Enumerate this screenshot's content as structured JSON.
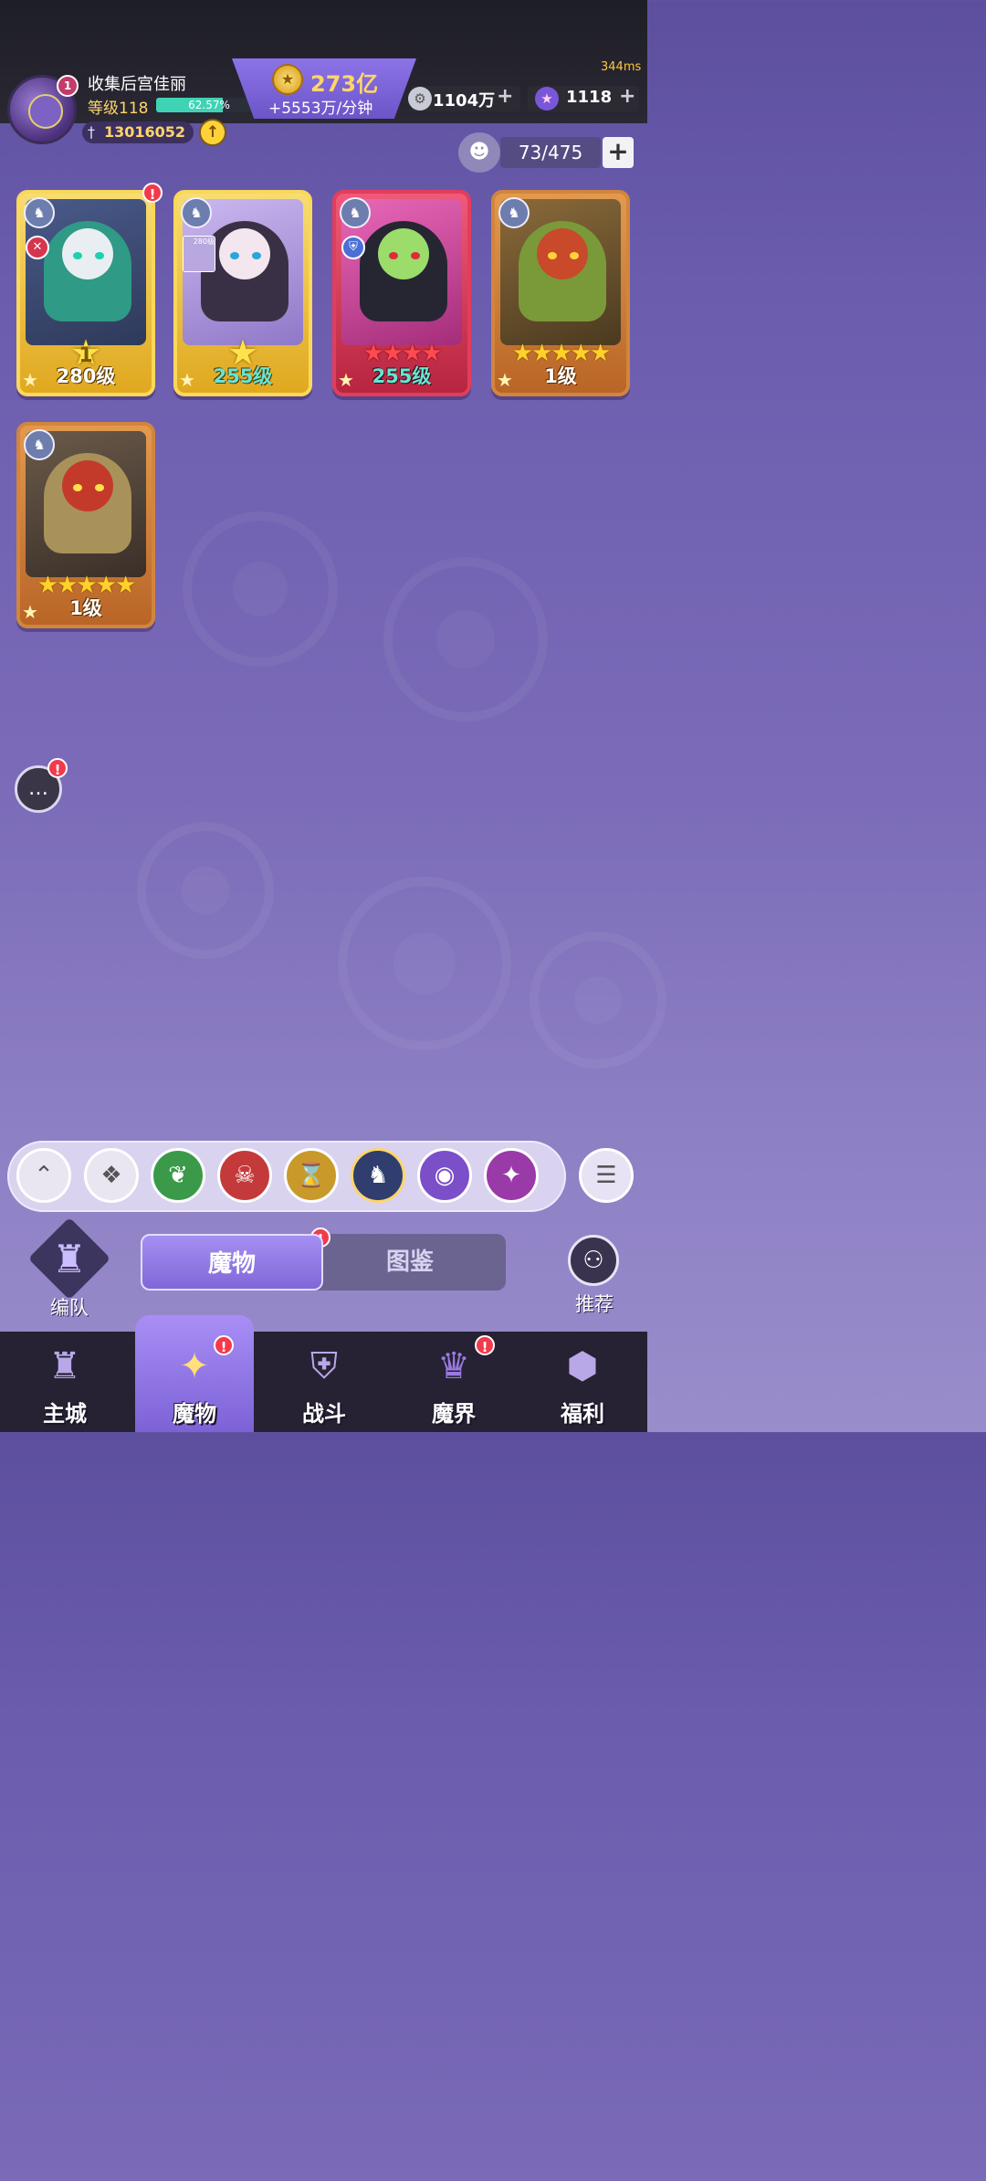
{
  "status": {
    "latency": "344ms"
  },
  "player": {
    "name": "收集后宫佳丽",
    "level_label": "等级118",
    "exp_percent_text": "62.57%",
    "exp_fraction": 0.6257,
    "power": "13016052",
    "avatar_badge": "1"
  },
  "gold": {
    "amount": "273亿",
    "rate": "+5553万/分钟"
  },
  "currencies": [
    {
      "name": "silver-coin",
      "value": "1104万",
      "plus": "+"
    },
    {
      "name": "star-gem",
      "value": "1118",
      "plus": "+"
    }
  ],
  "capacity": {
    "text": "73/475",
    "add": "+"
  },
  "cards": [
    {
      "frame": "gold",
      "level": "280级",
      "star_rank": "1",
      "tag": "sword"
    },
    {
      "frame": "gold",
      "level": "255级",
      "star_rank": "",
      "mini_label": "280级"
    },
    {
      "frame": "red",
      "level": "255级",
      "stars": "★★★★",
      "tag": "shield"
    },
    {
      "frame": "orange",
      "level": "1级",
      "stars": "★★★★★"
    },
    {
      "frame": "orange",
      "level": "1级",
      "stars": "★★★★★"
    }
  ],
  "notif_mark": "!",
  "filters": [
    {
      "name": "filter-all",
      "glyph": "⌃"
    },
    {
      "name": "filter-diamond",
      "glyph": "❖"
    },
    {
      "name": "filter-nature",
      "glyph": "❦",
      "color": "#3a9a4a"
    },
    {
      "name": "filter-demon",
      "glyph": "☠",
      "color": "#c43a3a"
    },
    {
      "name": "filter-time",
      "glyph": "⌛",
      "color": "#c99a2a"
    },
    {
      "name": "filter-dragon",
      "glyph": "♞",
      "color": "#2f3e6e"
    },
    {
      "name": "filter-eye",
      "glyph": "◉",
      "color": "#7a4fc8"
    },
    {
      "name": "filter-chaos",
      "glyph": "✦",
      "color": "#9a3aa8"
    }
  ],
  "tabs": {
    "formation": "编队",
    "monsters": "魔物",
    "codex": "图鉴",
    "recommend": "推荐"
  },
  "nav": [
    {
      "label": "主城",
      "glyph": "♜"
    },
    {
      "label": "魔物",
      "glyph": "✦"
    },
    {
      "label": "战斗",
      "glyph": "⛨"
    },
    {
      "label": "魔界",
      "glyph": "♛"
    },
    {
      "label": "福利",
      "glyph": "⬢"
    }
  ]
}
